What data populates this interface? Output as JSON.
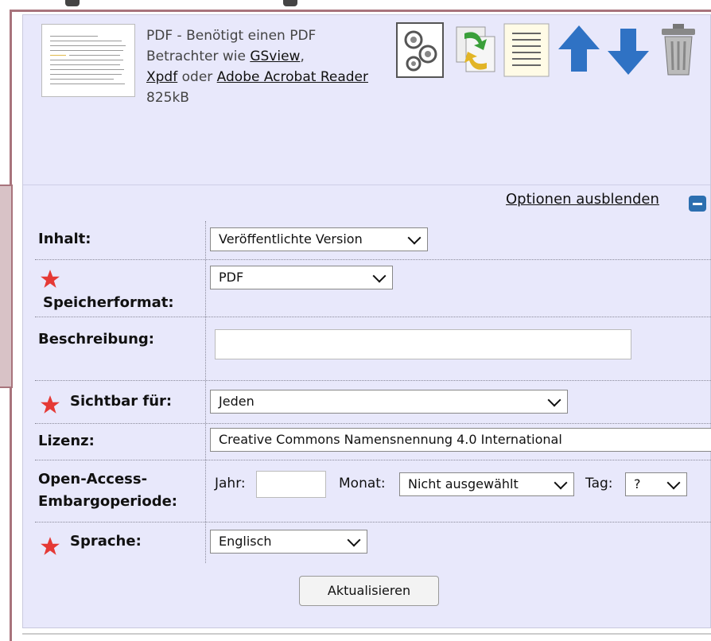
{
  "file": {
    "type": "PDF",
    "desc_prefix": " - Benötigt einen PDF Betrachter wie ",
    "links": [
      "GSview",
      "Xpdf",
      "Adobe Acrobat Reader"
    ],
    "sep1": ", ",
    "sep2": " oder ",
    "size": "825kB"
  },
  "toolbar": {
    "icons": [
      "gears-icon",
      "replace-icon",
      "details-icon",
      "arrow-up-icon",
      "arrow-down-icon",
      "trash-icon"
    ]
  },
  "options": {
    "hide_label": "Optionen ausblenden"
  },
  "form": {
    "content_label": "Inhalt:",
    "content_value": "Veröffentlichte Version",
    "format_label": "Speicherformat:",
    "format_value": "PDF",
    "description_label": "Beschreibung:",
    "description_value": "",
    "visible_label": "Sichtbar für:",
    "visible_value": "Jeden",
    "license_label": "Lizenz:",
    "license_value": "Creative Commons Namensnennung 4.0 International",
    "embargo_label_1": "Open-Access-",
    "embargo_label_2": "Embargoperiode:",
    "year_label": "Jahr:",
    "year_value": "",
    "month_label": "Monat:",
    "month_value": "Nicht ausgewählt",
    "day_label": "Tag:",
    "day_value": "?",
    "language_label": "Sprache:",
    "language_value": "Englisch"
  },
  "actions": {
    "update_label": "Aktualisieren"
  },
  "colors": {
    "panel": "#e8e8fb",
    "border": "#a8747c",
    "required_star": "#e53935",
    "arrow_blue": "#2f72c4"
  }
}
